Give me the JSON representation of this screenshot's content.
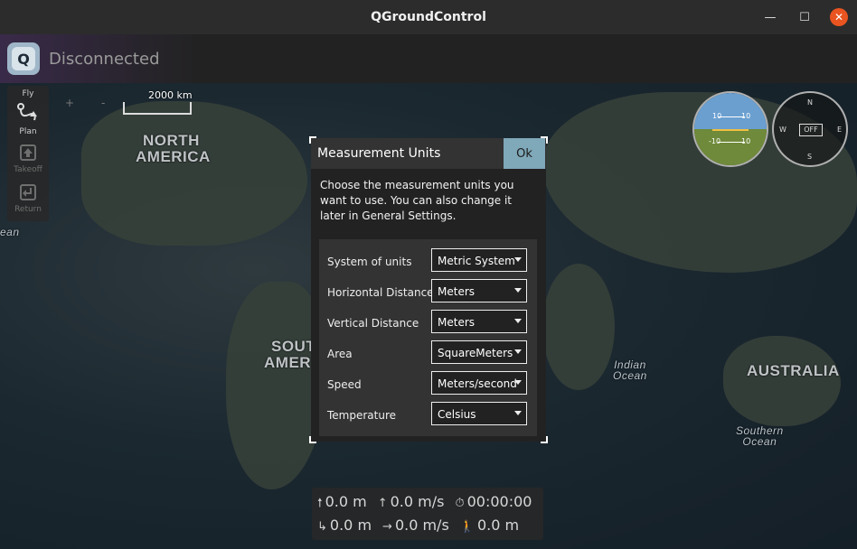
{
  "window": {
    "title": "QGroundControl",
    "minimize_glyph": "—",
    "maximize_glyph": "☐",
    "close_glyph": "✕"
  },
  "toolbar": {
    "logo_letter": "Q",
    "status": "Disconnected"
  },
  "sidebar": {
    "items": [
      {
        "label": "Fly",
        "icon": "fly-icon",
        "enabled": true
      },
      {
        "label": "Plan",
        "icon": "plan-route-icon",
        "enabled": true
      },
      {
        "label": "Takeoff",
        "icon": "takeoff-icon",
        "enabled": false
      },
      {
        "label": "Return",
        "icon": "return-icon",
        "enabled": false
      }
    ]
  },
  "map": {
    "scale_label": "2000 km",
    "zoom_in": "+",
    "zoom_out": "-",
    "labels": {
      "north_america_1": "NORTH",
      "north_america_2": "AMERICA",
      "south_america_1": "SOUT",
      "south_america_2": "AMER",
      "australia": "AUSTRALIA",
      "indian_ocean_1": "Indian",
      "indian_ocean_2": "Ocean",
      "southern_ocean_1": "Southern",
      "southern_ocean_2": "Ocean",
      "ocean_left": "ean"
    }
  },
  "instruments": {
    "attitude_upper_left": "10",
    "attitude_upper_right": "10",
    "attitude_lower_left": "-10",
    "attitude_lower_right": "10",
    "compass_n": "N",
    "compass_e": "E",
    "compass_s": "S",
    "compass_w": "W",
    "compass_mode": "OFF"
  },
  "dialog": {
    "title": "Measurement Units",
    "ok_label": "Ok",
    "intro": "Choose the measurement units you want to use. You can also change it later in General Settings.",
    "rows": [
      {
        "label": "System of units",
        "value": "Metric System"
      },
      {
        "label": "Horizontal Distance",
        "value": "Meters"
      },
      {
        "label": "Vertical Distance",
        "value": "Meters"
      },
      {
        "label": "Area",
        "value": "SquareMeters"
      },
      {
        "label": "Speed",
        "value": "Meters/second"
      },
      {
        "label": "Temperature",
        "value": "Celsius"
      }
    ]
  },
  "telemetry": {
    "altitude": "0.0 m",
    "climb_rate": "0.0 m/s",
    "flight_time": "00:00:00",
    "distance": "0.0 m",
    "ground_speed": "0.0 m/s",
    "distance_home": "0.0 m"
  }
}
